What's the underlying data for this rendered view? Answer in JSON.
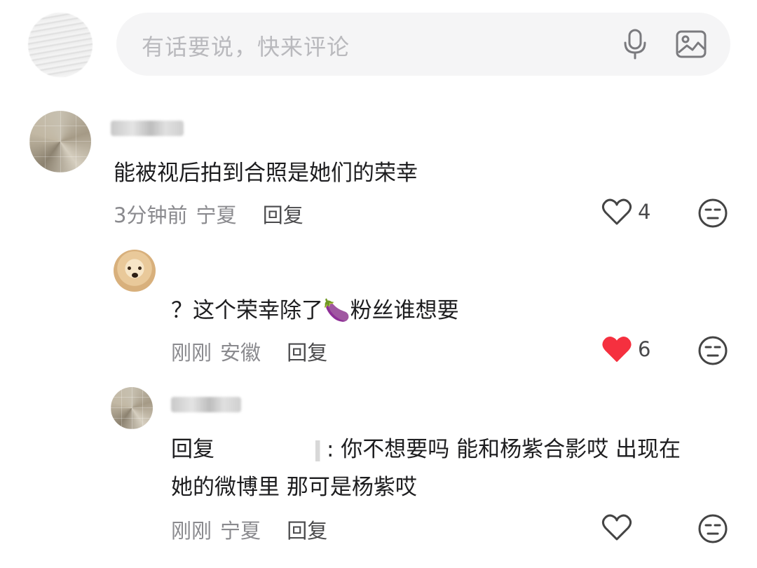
{
  "input_bar": {
    "placeholder": "有话要说，快来评论",
    "mic_icon": "microphone-icon",
    "image_icon": "image-icon"
  },
  "comments": [
    {
      "text": "能被视后拍到合照是她们的荣幸",
      "time": "3分钟前",
      "location": "宁夏",
      "reply_label": "回复",
      "likes": "4",
      "liked": false
    },
    {
      "text": "？这个荣幸除了🍆粉丝谁想要",
      "time": "刚刚",
      "location": "安徽",
      "reply_label": "回复",
      "likes": "6",
      "liked": true
    },
    {
      "text_prefix": "回复",
      "text_line1": ": 你不想要吗  能和杨紫合影哎  出现在",
      "text_line2": "她的微博里 那可是杨紫哎",
      "time": "刚刚",
      "location": "宁夏",
      "reply_label": "回复",
      "likes": "",
      "liked": false
    }
  ],
  "colors": {
    "heart_liked": "#f5303f",
    "meta_text": "#8a8a8e",
    "input_bg": "#f5f5f6"
  }
}
